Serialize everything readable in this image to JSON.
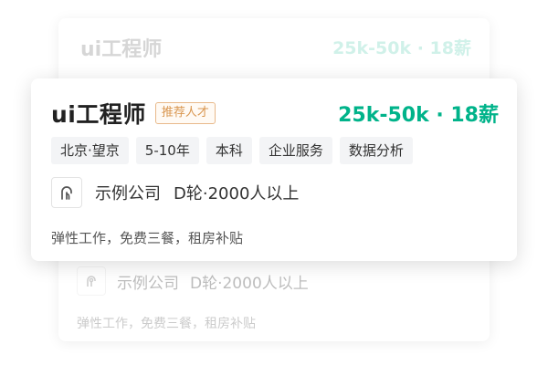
{
  "background_card": {
    "title": "ui工程师",
    "salary": "25k-50k · 18薪",
    "company_name": "示例公司",
    "company_info": "D轮·2000人以上",
    "benefits": "弹性工作，免费三餐，租房补贴"
  },
  "job_card": {
    "title": "ui工程师",
    "badge": "推荐人才",
    "salary": "25k-50k · 18薪",
    "tags": [
      "北京·望京",
      "5-10年",
      "本科",
      "企业服务",
      "数据分析"
    ],
    "company": {
      "logo_icon": "company-logo-icon",
      "name": "示例公司",
      "info": "D轮·2000人以上"
    },
    "benefits": "弹性工作，免费三餐，租房补贴"
  },
  "colors": {
    "salary": "#00b38a",
    "badge_text": "#d9964f",
    "badge_border": "#e8b98a",
    "tag_bg": "#f3f4f6"
  }
}
